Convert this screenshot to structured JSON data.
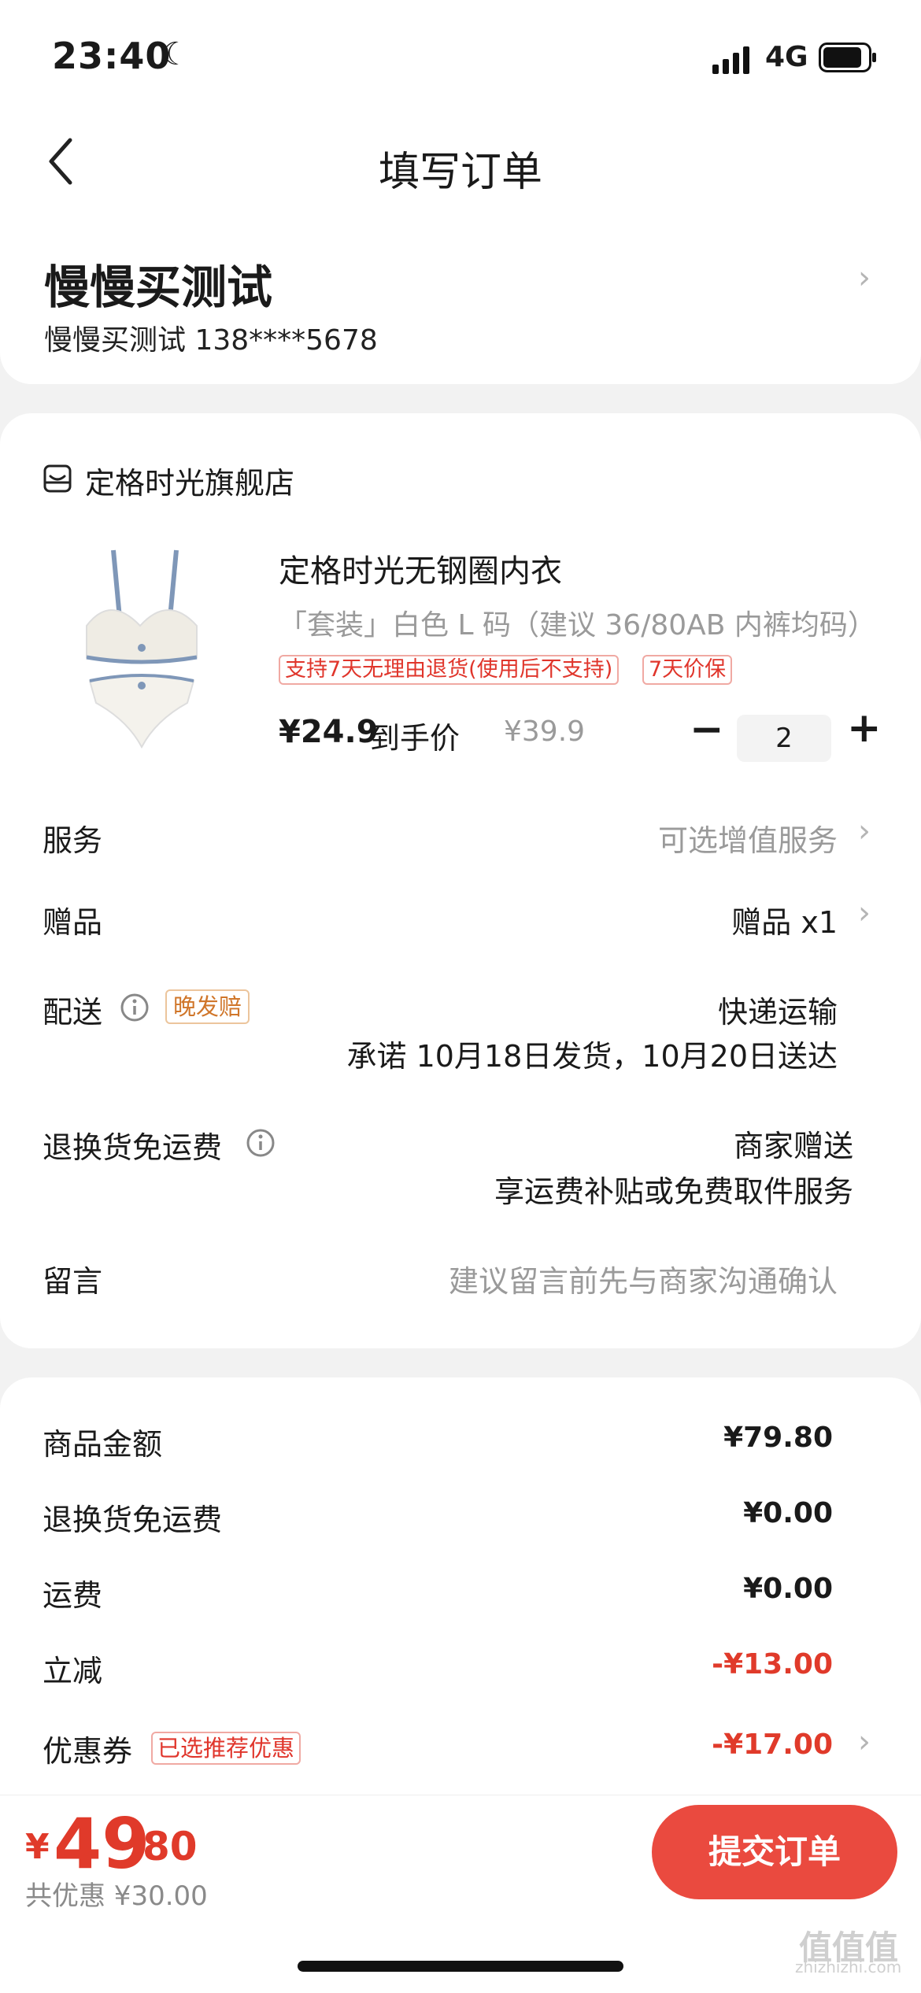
{
  "status": {
    "time": "23:40",
    "network": "4G"
  },
  "nav": {
    "title": "填写订单"
  },
  "address": {
    "name": "慢慢买测试",
    "contact": "慢慢买测试  138****5678"
  },
  "shop": {
    "name": "定格时光旗舰店"
  },
  "product": {
    "title": "定格时光无钢圈内衣",
    "spec": "「套装」白色  L 码（建议 36/80AB 内裤均码）",
    "tags": [
      "支持7天无理由退货(使用后不支持)",
      "7天价保"
    ],
    "price_now": "¥24.9",
    "price_label": "到手价",
    "price_old": "¥39.9",
    "quantity": "2",
    "minus": "−",
    "plus": "+"
  },
  "rows": {
    "service": {
      "label": "服务",
      "value": "可选增值服务"
    },
    "gift": {
      "label": "赠品",
      "value": "赠品 x1"
    },
    "delivery": {
      "label": "配送",
      "tag": "晚发赔",
      "value": "快递运输",
      "note": "承诺 10月18日发货，10月20日送达"
    },
    "return_free": {
      "label": "退换货免运费",
      "value": "商家赠送",
      "note": "享运费补贴或免费取件服务"
    },
    "message": {
      "label": "留言",
      "placeholder": "建议留言前先与商家沟通确认"
    }
  },
  "summary": {
    "goods_amount": {
      "label": "商品金额",
      "value": "¥79.80"
    },
    "return_free": {
      "label": "退换货免运费",
      "value": "¥0.00"
    },
    "shipping": {
      "label": "运费",
      "value": "¥0.00"
    },
    "instant_discount": {
      "label": "立减",
      "value": "-¥13.00"
    },
    "coupon": {
      "label": "优惠券",
      "tag": "已选推荐优惠",
      "value": "-¥17.00"
    }
  },
  "footer": {
    "currency": "¥",
    "total_int": "49",
    "total_dec": ".80",
    "saving": "共优惠 ¥30.00",
    "submit_label": "提交订单"
  },
  "watermark": {
    "text": "值值值",
    "sub": "zhizhizhi.com"
  },
  "colors": {
    "accent": "#ea4a3f",
    "price_red": "#e03a2a",
    "tag_orange": "#d0762a"
  }
}
